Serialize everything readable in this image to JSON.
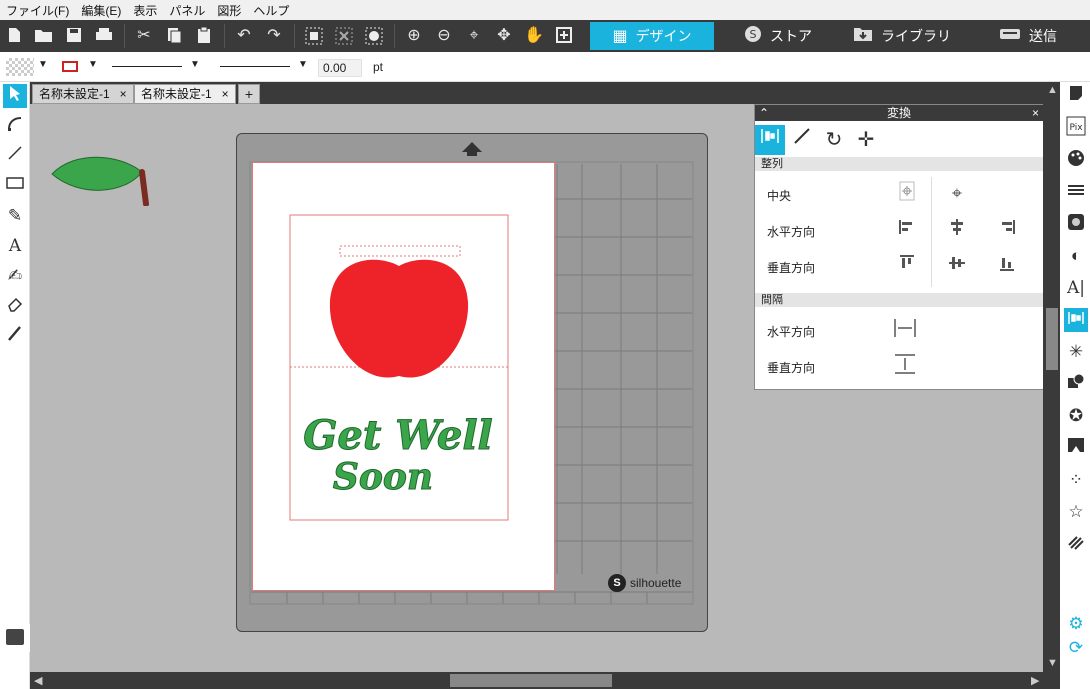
{
  "menu": [
    "ファイル(F)",
    "編集(E)",
    "表示",
    "パネル",
    "図形",
    "ヘルプ"
  ],
  "toolbar": {
    "tabs": [
      {
        "label": "デザイン",
        "icon": "grid-icon",
        "active": true
      },
      {
        "label": "ストア",
        "icon": "silhouette-logo-icon",
        "active": false
      },
      {
        "label": "ライブラリ",
        "icon": "folder-download-icon",
        "active": false
      },
      {
        "label": "送信",
        "icon": "cutter-icon",
        "active": false
      }
    ]
  },
  "options": {
    "line_width": "0.00",
    "unit": "pt"
  },
  "doc_tabs": [
    {
      "label": "名称未設定-1",
      "close": "×"
    },
    {
      "label": "名称未設定-1",
      "close": "×"
    }
  ],
  "doc_tab_add": "+",
  "design": {
    "text_line1": "Get Well",
    "text_line2": "Soon",
    "apple_color": "#ee2229",
    "leaf_color": "#3aa54a"
  },
  "brand": "silhouette",
  "transform_panel": {
    "title": "変換",
    "close": "×",
    "section_align": "整列",
    "section_space": "間隔",
    "rows": {
      "center": "中央",
      "horizontal": "水平方向",
      "vertical": "垂直方向",
      "space_h": "水平方向",
      "space_v": "垂直方向"
    }
  },
  "colors": {
    "accent": "#1ab3dd",
    "toolbar_bg": "#3a3a3a",
    "canvas_bg": "#b9b9b9"
  }
}
